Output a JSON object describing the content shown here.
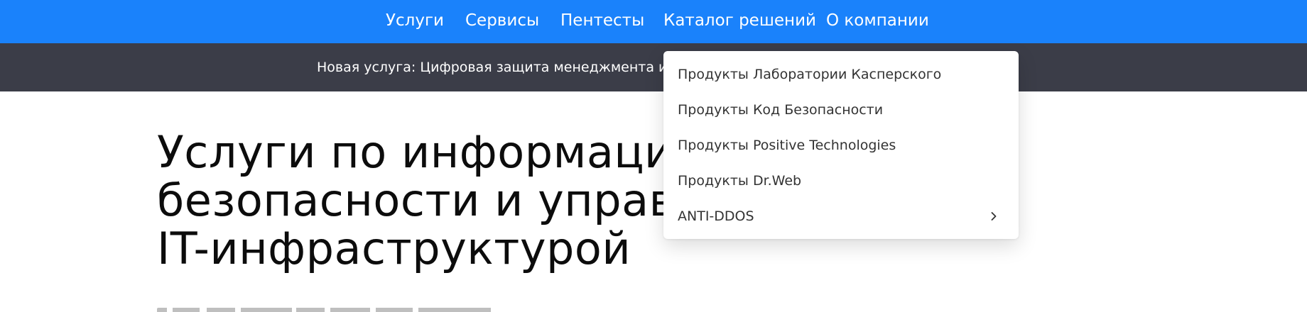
{
  "nav": {
    "items": [
      {
        "label": "Услуги"
      },
      {
        "label": "Сервисы"
      },
      {
        "label": "Пентесты"
      },
      {
        "label": "Каталог решений"
      },
      {
        "label": "О компании"
      }
    ]
  },
  "colors": {
    "nav_background": "#1a82fb",
    "announce_background": "#3b3d48"
  },
  "announcement": {
    "text": "Новая услуга: Цифровая защита менеджмента и первых"
  },
  "hero": {
    "title_lines": [
      "Услуги по информацион",
      "безопасности и управле",
      "IT-инфраструктурой"
    ]
  },
  "catalog_menu": {
    "items": [
      {
        "label": "Продукты Лаборатории Касперского"
      },
      {
        "label": "Продукты Код Безопасности"
      },
      {
        "label": "Продукты Positive Technologies"
      },
      {
        "label": "Продукты Dr.Web"
      },
      {
        "label": "ANTI-DDOS",
        "icon": "chevron-right-icon"
      }
    ]
  }
}
